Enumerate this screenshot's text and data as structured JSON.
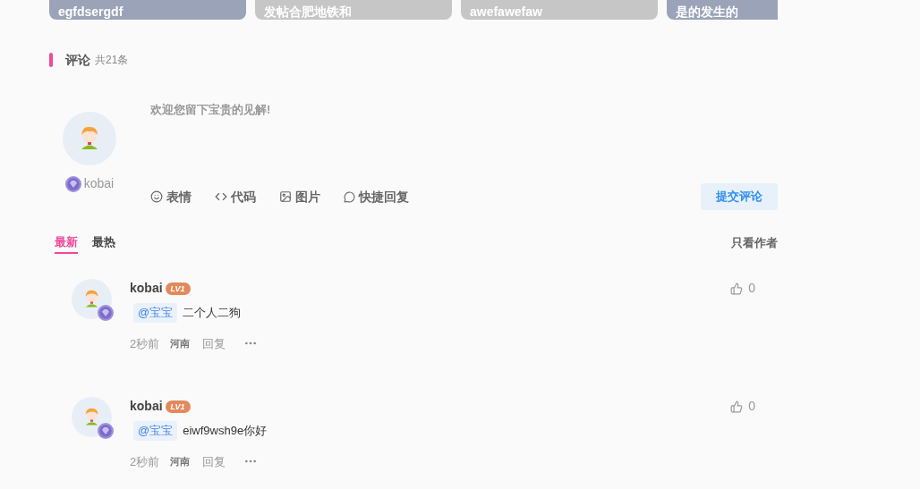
{
  "cards": [
    {
      "title": "egfdsergdf",
      "kind": "photo"
    },
    {
      "title": "发帖合肥地铁和",
      "kind": "plain"
    },
    {
      "title": "awefawefaw",
      "kind": "plain"
    },
    {
      "title": "是的发生的",
      "kind": "photo"
    }
  ],
  "comments_header": {
    "title": "评论",
    "count": "共21条"
  },
  "editor": {
    "user": "kobai",
    "placeholder": "欢迎您留下宝贵的见解!",
    "tools": [
      {
        "kind": "emoji",
        "label": "表情"
      },
      {
        "kind": "code",
        "label": "代码"
      },
      {
        "kind": "image",
        "label": "图片"
      },
      {
        "kind": "quick",
        "label": "快捷回复"
      }
    ],
    "submit": "提交评论"
  },
  "sort_tabs": [
    {
      "label": "最新",
      "selected": true
    },
    {
      "label": "最热",
      "selected": false
    }
  ],
  "author_only": "只看作者",
  "comments": [
    {
      "user": "kobai",
      "level": "LV1",
      "mention": "@宝宝",
      "text": "二个人二狗",
      "time": "2秒前",
      "location": "河南",
      "reply": "回复",
      "likes": "0"
    },
    {
      "user": "kobai",
      "level": "LV1",
      "mention": "@宝宝",
      "text": "eiwf9wsh9e你好",
      "time": "2秒前",
      "location": "河南",
      "reply": "回复",
      "likes": "0"
    }
  ]
}
